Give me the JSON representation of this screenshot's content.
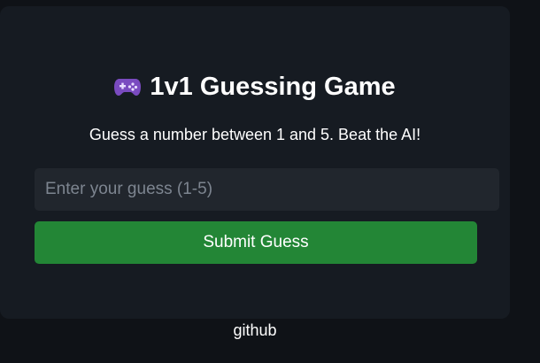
{
  "game": {
    "title": "1v1 Guessing Game",
    "title_icon": "gamepad-icon",
    "subtitle": "Guess a number between 1 and 5. Beat the AI!"
  },
  "form": {
    "guess_value": "",
    "guess_placeholder": "Enter your guess (1-5)",
    "submit_label": "Submit Guess"
  },
  "footer": {
    "link_label": "github"
  },
  "colors": {
    "page_background": "#0f1217",
    "card_background": "#161b22",
    "input_background": "#21262d",
    "button_green": "#238636",
    "text": "#ffffff",
    "placeholder": "#7d8590",
    "icon_purple": "#7a4bc0"
  }
}
